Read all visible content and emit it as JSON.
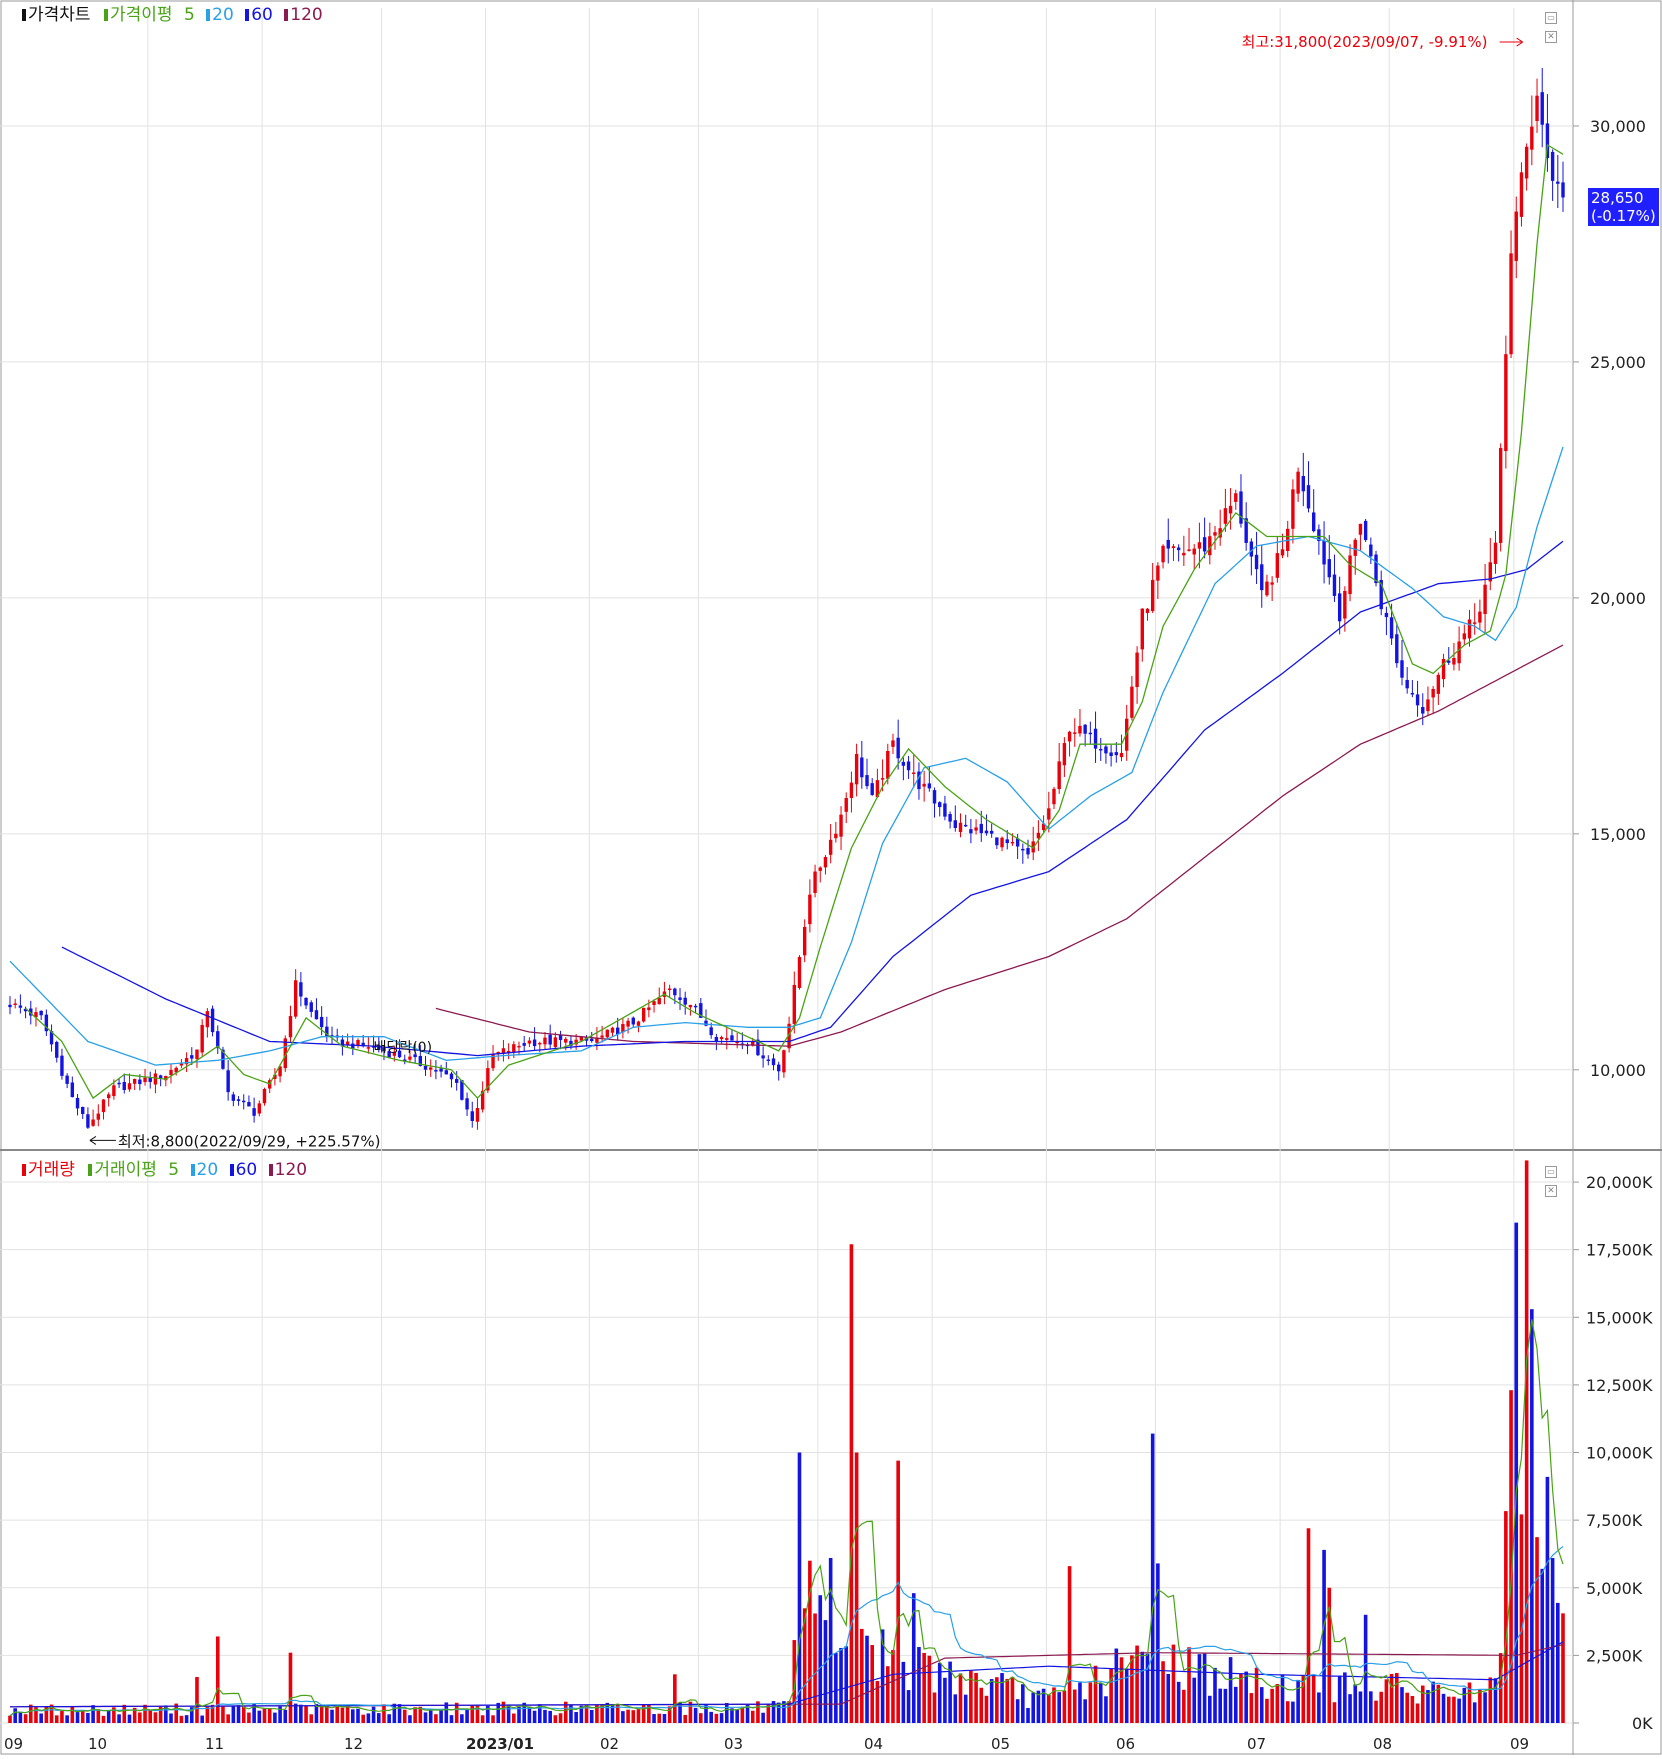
{
  "colors": {
    "up": "#e8000b",
    "down": "#1414e0",
    "ma5": "#4aa316",
    "ma20": "#2aa0e6",
    "ma60": "#1414e0",
    "ma120": "#8b1a50",
    "grid": "#e2e2e2",
    "axis_text": "#222222",
    "annotation": "#e8000b"
  },
  "price_panel": {
    "legend": {
      "title": "가격차트",
      "ma_label": "가격이평",
      "ma5": "5",
      "ma20": "20",
      "ma60": "60",
      "ma120": "120"
    },
    "high_annotation": "최고:31,800(2023/09/07, -9.91%)",
    "low_annotation": "최저:8,800(2022/09/29, +225.57%)",
    "event_label": "배당락(0)",
    "current_price": "28,650",
    "current_change": "(-0.17%)"
  },
  "volume_panel": {
    "legend": {
      "title": "거래량",
      "ma_label": "거래이평",
      "ma5": "5",
      "ma20": "20",
      "ma60": "60",
      "ma120": "120"
    }
  },
  "chart_data": [
    {
      "type": "candlestick",
      "title": "가격차트",
      "ylim": [
        8300,
        32500
      ],
      "y_ticks": [
        "10,000",
        "15,000",
        "20,000",
        "25,000",
        "30,000"
      ],
      "x_ticks": [
        "09",
        "10",
        "11",
        "12",
        "2023/01",
        "02",
        "03",
        "04",
        "05",
        "06",
        "07",
        "08",
        "09"
      ],
      "price_path": [
        [
          0,
          11400
        ],
        [
          6,
          11100
        ],
        [
          12,
          9400
        ],
        [
          15,
          8800
        ],
        [
          20,
          9600
        ],
        [
          30,
          9900
        ],
        [
          36,
          10400
        ],
        [
          38,
          11300
        ],
        [
          42,
          9500
        ],
        [
          47,
          9100
        ],
        [
          52,
          10100
        ],
        [
          55,
          11800
        ],
        [
          58,
          11200
        ],
        [
          62,
          10600
        ],
        [
          69,
          10500
        ],
        [
          75,
          10300
        ],
        [
          82,
          10000
        ],
        [
          86,
          9700
        ],
        [
          89,
          8900
        ],
        [
          93,
          10300
        ],
        [
          100,
          10600
        ],
        [
          112,
          10600
        ],
        [
          120,
          11000
        ],
        [
          127,
          11700
        ],
        [
          131,
          11400
        ],
        [
          136,
          10700
        ],
        [
          142,
          10600
        ],
        [
          148,
          10000
        ],
        [
          150,
          11000
        ],
        [
          154,
          13800
        ],
        [
          160,
          15400
        ],
        [
          163,
          16600
        ],
        [
          166,
          15700
        ],
        [
          170,
          16900
        ],
        [
          174,
          16200
        ],
        [
          182,
          15200
        ],
        [
          190,
          14900
        ],
        [
          196,
          14500
        ],
        [
          200,
          15500
        ],
        [
          204,
          17300
        ],
        [
          208,
          17000
        ],
        [
          214,
          16700
        ],
        [
          218,
          19600
        ],
        [
          222,
          20900
        ],
        [
          230,
          21100
        ],
        [
          236,
          22100
        ],
        [
          241,
          20000
        ],
        [
          245,
          21000
        ],
        [
          248,
          22800
        ],
        [
          252,
          21200
        ],
        [
          256,
          19700
        ],
        [
          260,
          21700
        ],
        [
          264,
          19900
        ],
        [
          268,
          18300
        ],
        [
          272,
          17700
        ],
        [
          276,
          18600
        ],
        [
          282,
          19500
        ],
        [
          286,
          21000
        ],
        [
          289,
          27400
        ],
        [
          292,
          29500
        ],
        [
          294,
          30800
        ],
        [
          296,
          29300
        ],
        [
          298,
          28650
        ]
      ],
      "ma5_path": [
        [
          3,
          11300
        ],
        [
          10,
          10600
        ],
        [
          16,
          9400
        ],
        [
          22,
          9900
        ],
        [
          30,
          9800
        ],
        [
          36,
          10200
        ],
        [
          40,
          10500
        ],
        [
          45,
          9900
        ],
        [
          50,
          9700
        ],
        [
          57,
          11100
        ],
        [
          64,
          10500
        ],
        [
          75,
          10200
        ],
        [
          85,
          10000
        ],
        [
          90,
          9400
        ],
        [
          96,
          10100
        ],
        [
          110,
          10600
        ],
        [
          126,
          11600
        ],
        [
          132,
          11200
        ],
        [
          140,
          10800
        ],
        [
          148,
          10400
        ],
        [
          152,
          11100
        ],
        [
          156,
          12600
        ],
        [
          162,
          14700
        ],
        [
          168,
          16000
        ],
        [
          173,
          16800
        ],
        [
          180,
          16000
        ],
        [
          188,
          15300
        ],
        [
          197,
          14700
        ],
        [
          202,
          15500
        ],
        [
          206,
          16900
        ],
        [
          214,
          16900
        ],
        [
          218,
          17800
        ],
        [
          222,
          19400
        ],
        [
          228,
          20600
        ],
        [
          236,
          21800
        ],
        [
          242,
          21300
        ],
        [
          247,
          21300
        ],
        [
          253,
          21300
        ],
        [
          258,
          20700
        ],
        [
          264,
          20300
        ],
        [
          270,
          18600
        ],
        [
          274,
          18400
        ],
        [
          280,
          19000
        ],
        [
          285,
          19300
        ],
        [
          288,
          20500
        ],
        [
          291,
          23500
        ],
        [
          294,
          27500
        ],
        [
          296,
          29600
        ],
        [
          299,
          29400
        ]
      ],
      "ma20_path": [
        [
          0,
          12300
        ],
        [
          15,
          10600
        ],
        [
          28,
          10100
        ],
        [
          40,
          10200
        ],
        [
          50,
          10400
        ],
        [
          60,
          10700
        ],
        [
          72,
          10700
        ],
        [
          84,
          10200
        ],
        [
          95,
          10300
        ],
        [
          110,
          10400
        ],
        [
          120,
          10900
        ],
        [
          130,
          11000
        ],
        [
          142,
          10900
        ],
        [
          150,
          10900
        ],
        [
          156,
          11100
        ],
        [
          162,
          12700
        ],
        [
          168,
          14800
        ],
        [
          176,
          16400
        ],
        [
          184,
          16600
        ],
        [
          192,
          16100
        ],
        [
          200,
          15100
        ],
        [
          208,
          15800
        ],
        [
          216,
          16300
        ],
        [
          222,
          18000
        ],
        [
          232,
          20300
        ],
        [
          240,
          21100
        ],
        [
          250,
          21300
        ],
        [
          260,
          21000
        ],
        [
          270,
          20200
        ],
        [
          276,
          19600
        ],
        [
          282,
          19400
        ],
        [
          286,
          19100
        ],
        [
          290,
          19800
        ],
        [
          294,
          21500
        ],
        [
          299,
          23200
        ]
      ],
      "ma60_path": [
        [
          10,
          12600
        ],
        [
          30,
          11500
        ],
        [
          50,
          10600
        ],
        [
          70,
          10500
        ],
        [
          90,
          10300
        ],
        [
          110,
          10500
        ],
        [
          130,
          10600
        ],
        [
          150,
          10600
        ],
        [
          158,
          10900
        ],
        [
          170,
          12400
        ],
        [
          185,
          13700
        ],
        [
          200,
          14200
        ],
        [
          215,
          15300
        ],
        [
          230,
          17200
        ],
        [
          245,
          18400
        ],
        [
          260,
          19700
        ],
        [
          275,
          20300
        ],
        [
          285,
          20400
        ],
        [
          292,
          20600
        ],
        [
          299,
          21200
        ]
      ],
      "ma120_path": [
        [
          82,
          11300
        ],
        [
          100,
          10800
        ],
        [
          120,
          10600
        ],
        [
          150,
          10500
        ],
        [
          160,
          10800
        ],
        [
          180,
          11700
        ],
        [
          200,
          12400
        ],
        [
          215,
          13200
        ],
        [
          230,
          14500
        ],
        [
          245,
          15800
        ],
        [
          260,
          16900
        ],
        [
          275,
          17600
        ],
        [
          287,
          18300
        ],
        [
          299,
          19000
        ]
      ],
      "high": {
        "date": "2023/09/07",
        "value": 31800
      },
      "low": {
        "date": "2022/09/29",
        "value": 8800
      },
      "last_close": 28650
    },
    {
      "type": "bar",
      "title": "거래량",
      "ylim": [
        0,
        21000
      ],
      "unit": "K",
      "y_ticks": [
        "0K",
        "2,500K",
        "5,000K",
        "7,500K",
        "10,000K",
        "12,500K",
        "15,000K",
        "17,500K",
        "20,000K"
      ],
      "x_ticks": [
        "09",
        "10",
        "11",
        "12",
        "2023/01",
        "02",
        "03",
        "04",
        "05",
        "06",
        "07",
        "08",
        "09"
      ],
      "base_volume": [
        [
          0,
          500
        ],
        [
          150,
          600
        ],
        [
          152,
          3800
        ],
        [
          175,
          2200
        ],
        [
          200,
          900
        ],
        [
          220,
          2600
        ],
        [
          240,
          1500
        ],
        [
          286,
          1200
        ],
        [
          289,
          9000
        ],
        [
          299,
          3500
        ]
      ],
      "spikes": [
        [
          36,
          1700
        ],
        [
          40,
          3200
        ],
        [
          54,
          2600
        ],
        [
          61,
          650
        ],
        [
          128,
          1800
        ],
        [
          152,
          10000
        ],
        [
          154,
          6000
        ],
        [
          158,
          6100
        ],
        [
          162,
          17700
        ],
        [
          163,
          10000
        ],
        [
          171,
          9700
        ],
        [
          174,
          4800
        ],
        [
          204,
          5800
        ],
        [
          220,
          10700
        ],
        [
          221,
          5900
        ],
        [
          250,
          7200
        ],
        [
          253,
          6400
        ],
        [
          254,
          5000
        ],
        [
          261,
          4000
        ],
        [
          280,
          1300
        ],
        [
          290,
          18500
        ],
        [
          292,
          20800
        ],
        [
          293,
          15300
        ],
        [
          295,
          5700
        ],
        [
          296,
          9100
        ],
        [
          297,
          6100
        ]
      ],
      "ma5_peaks": [
        [
          36,
          900
        ],
        [
          160,
          6000
        ],
        [
          166,
          8000
        ],
        [
          176,
          5200
        ],
        [
          208,
          3200
        ],
        [
          224,
          5000
        ],
        [
          254,
          4800
        ],
        [
          290,
          9000
        ],
        [
          296,
          13800
        ],
        [
          299,
          5500
        ]
      ],
      "ma20_peaks": [
        [
          160,
          3000
        ],
        [
          176,
          5500
        ],
        [
          190,
          2500
        ],
        [
          224,
          3200
        ],
        [
          254,
          2500
        ],
        [
          292,
          4500
        ],
        [
          299,
          4800
        ]
      ],
      "ma60_level": [
        [
          0,
          600
        ],
        [
          150,
          700
        ],
        [
          170,
          1800
        ],
        [
          200,
          2100
        ],
        [
          240,
          1800
        ],
        [
          286,
          1600
        ],
        [
          299,
          3000
        ]
      ],
      "ma120_level": [
        [
          0,
          600
        ],
        [
          160,
          700
        ],
        [
          180,
          2400
        ],
        [
          220,
          2600
        ],
        [
          290,
          2500
        ],
        [
          299,
          2900
        ]
      ]
    }
  ]
}
